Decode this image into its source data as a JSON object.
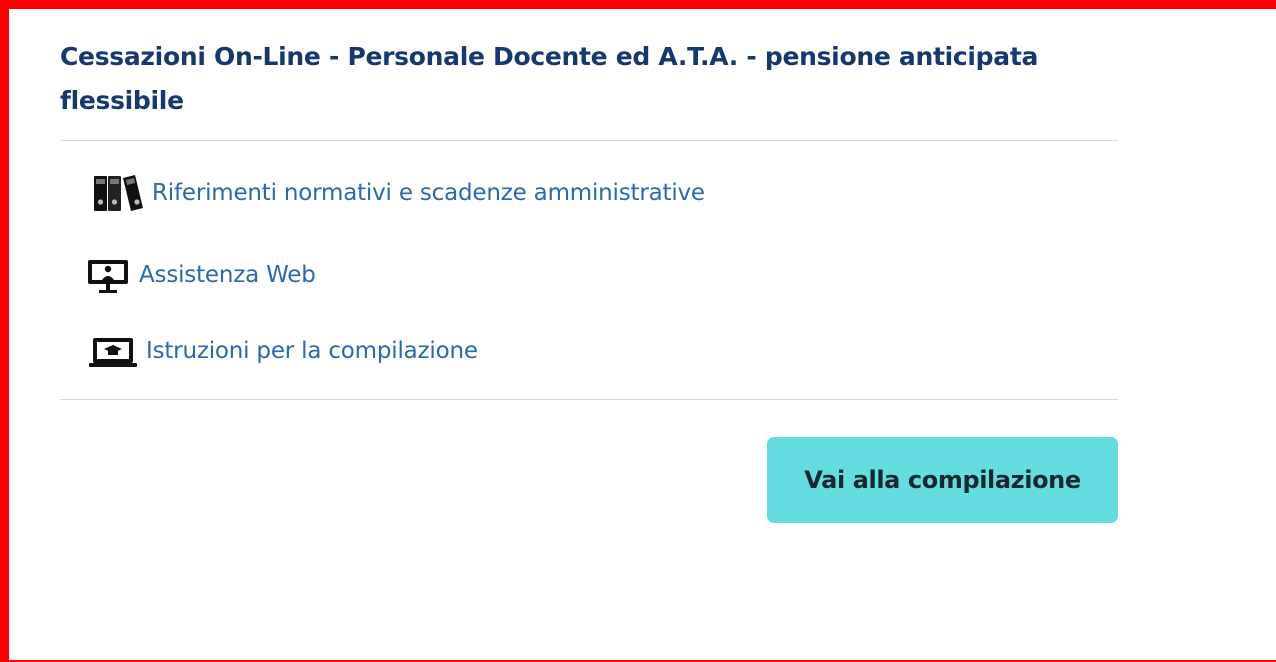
{
  "card": {
    "title": "Cessazioni On-Line - Personale Docente ed A.T.A. - pensione anticipata flessibile",
    "links": [
      {
        "icon": "binders-icon",
        "label": "Riferimenti normativi e scadenze amministrative"
      },
      {
        "icon": "monitor-user-icon",
        "label": "Assistenza Web"
      },
      {
        "icon": "laptop-graduation-icon",
        "label": "Istruzioni per la compilazione"
      }
    ],
    "primary_button_label": "Vai alla compilazione"
  },
  "colors": {
    "frame_border": "#ff0000",
    "title": "#17386f",
    "link": "#2c67b1",
    "button_bg": "#64dde1",
    "button_text": "#17272f",
    "divider": "#d9d9d9"
  }
}
